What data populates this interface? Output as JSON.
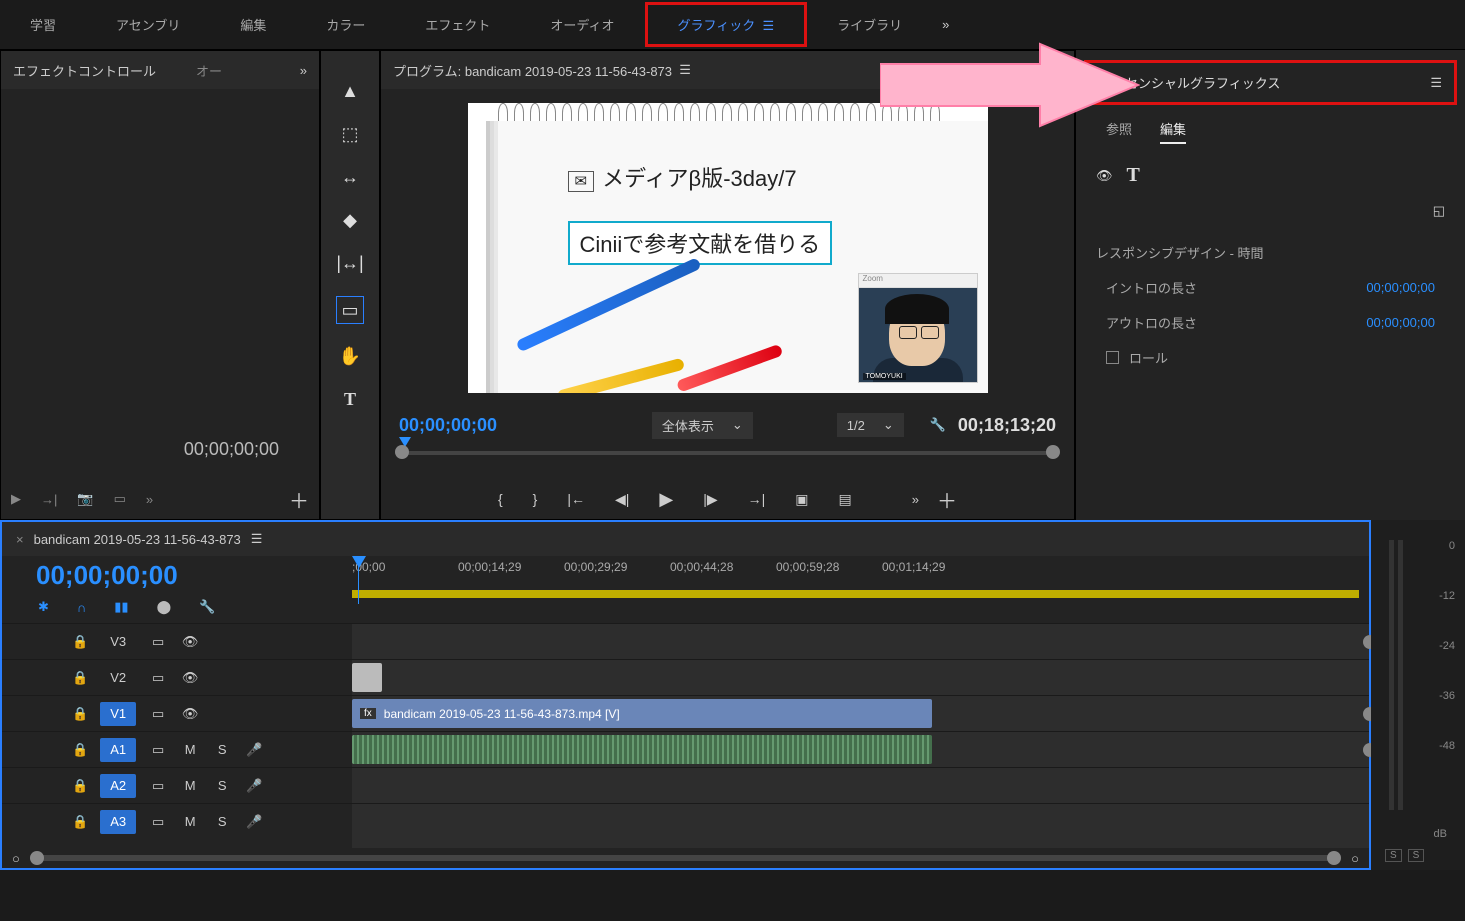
{
  "workspaces": [
    "学習",
    "アセンブリ",
    "編集",
    "カラー",
    "エフェクト",
    "オーディオ",
    "グラフィック",
    "ライブラリ"
  ],
  "ws_active": 6,
  "ws_more": "»",
  "ec_panel": {
    "title": "エフェクトコントロール",
    "title2": "オー",
    "more": "»",
    "time": "00;00;00;00"
  },
  "prog": {
    "title": "プログラム: bandicam 2019-05-23 11-56-43-873",
    "tc": "00;00;00;00",
    "dd1": "全体表示",
    "dd2": "1/2",
    "tc_r": "00;18;13;20"
  },
  "preview": {
    "line1": "メディアβ版-3day/7",
    "line2": "Ciniiで参考文献を借りる",
    "zoom_app": "Zoom",
    "tag": "TOMOYUKI"
  },
  "eg": {
    "title": "エッセンシャルグラフィックス",
    "tabs": [
      "参照",
      "編集"
    ],
    "active": 1,
    "section": "レスポンシブデザイン  -  時間",
    "rows": [
      [
        "イントロの長さ",
        "00;00;00;00"
      ],
      [
        "アウトロの長さ",
        "00;00;00;00"
      ]
    ],
    "roll": "ロール"
  },
  "timeline": {
    "title": "bandicam 2019-05-23 11-56-43-873",
    "tc": "00;00;00;00",
    "ruler": [
      ";00;00",
      "00;00;14;29",
      "00;00;29;29",
      "00;00;44;28",
      "00;00;59;28",
      "00;01;14;29"
    ],
    "tracks": [
      {
        "lock": "🔒",
        "name": "V3",
        "toggle": "▭",
        "eye": "👁",
        "type": "v"
      },
      {
        "lock": "🔒",
        "name": "V2",
        "toggle": "▭",
        "eye": "👁",
        "type": "v"
      },
      {
        "lock": "🔒",
        "name": "V1",
        "toggle": "▭",
        "eye": "👁",
        "type": "v",
        "sel": true
      },
      {
        "lock": "🔒",
        "name": "A1",
        "toggle": "▭",
        "m": "M",
        "s": "S",
        "mic": "🎤",
        "type": "a",
        "sel": true
      },
      {
        "lock": "🔒",
        "name": "A2",
        "toggle": "▭",
        "m": "M",
        "s": "S",
        "mic": "🎤",
        "type": "a",
        "sel": true
      },
      {
        "lock": "🔒",
        "name": "A3",
        "toggle": "▭",
        "m": "M",
        "s": "S",
        "mic": "🎤",
        "type": "a",
        "sel": true
      }
    ],
    "clip_v": "bandicam 2019-05-23 11-56-43-873.mp4 [V]",
    "fx": "fx"
  },
  "meters": {
    "db": [
      "0",
      "-12",
      "-24",
      "-36",
      "-48"
    ],
    "unit": "dB",
    "s": "S"
  }
}
